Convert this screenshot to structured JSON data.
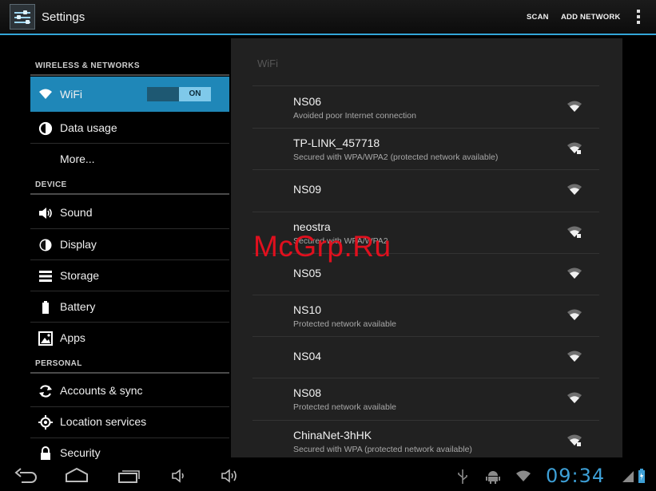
{
  "action_bar": {
    "title": "Settings",
    "scan_label": "SCAN",
    "add_network_label": "ADD NETWORK",
    "accent_color": "#33a6d8"
  },
  "left_panel": {
    "sections": [
      {
        "header": "WIRELESS & NETWORKS",
        "items": [
          {
            "label": "WiFi",
            "icon": "wifi-icon",
            "selected": true,
            "toggle": "ON"
          },
          {
            "label": "Data usage",
            "icon": "data-usage-icon"
          },
          {
            "label": "More...",
            "icon": ""
          }
        ]
      },
      {
        "header": "DEVICE",
        "items": [
          {
            "label": "Sound",
            "icon": "speaker-icon"
          },
          {
            "label": "Display",
            "icon": "display-icon"
          },
          {
            "label": "Storage",
            "icon": "storage-icon"
          },
          {
            "label": "Battery",
            "icon": "battery-icon"
          },
          {
            "label": "Apps",
            "icon": "apps-icon"
          }
        ]
      },
      {
        "header": "PERSONAL",
        "items": [
          {
            "label": "Accounts & sync",
            "icon": "sync-icon"
          },
          {
            "label": "Location services",
            "icon": "location-icon"
          },
          {
            "label": "Security",
            "icon": "lock-icon"
          }
        ]
      }
    ],
    "selected_color": "#1f87b8"
  },
  "wifi_panel": {
    "title": "WiFi",
    "networks": [
      {
        "ssid": "NS06",
        "status": "Avoided poor Internet connection",
        "secured": false
      },
      {
        "ssid": "TP-LINK_457718",
        "status": "Secured with WPA/WPA2 (protected network available)",
        "secured": true
      },
      {
        "ssid": "NS09",
        "status": "",
        "secured": false
      },
      {
        "ssid": "neostra",
        "status": "Secured with WPA/WPA2",
        "secured": true
      },
      {
        "ssid": "NS05",
        "status": "",
        "secured": false
      },
      {
        "ssid": "NS10",
        "status": "Protected network available",
        "secured": false
      },
      {
        "ssid": "NS04",
        "status": "",
        "secured": false
      },
      {
        "ssid": "NS08",
        "status": "Protected network available",
        "secured": false
      },
      {
        "ssid": "ChinaNet-3hHK",
        "status": "Secured with WPA (protected network available)",
        "secured": true
      }
    ]
  },
  "watermark": "McGrp.Ru",
  "system_bar": {
    "clock": "09:34",
    "nav_icons": [
      "back-icon",
      "home-icon",
      "recent-apps-icon",
      "volume-down-icon",
      "volume-up-icon"
    ],
    "status_icons": [
      "usb-icon",
      "android-debug-icon",
      "wifi-status-icon",
      "signal-icon",
      "battery-status-icon"
    ],
    "clock_color": "#3d9fd6"
  }
}
